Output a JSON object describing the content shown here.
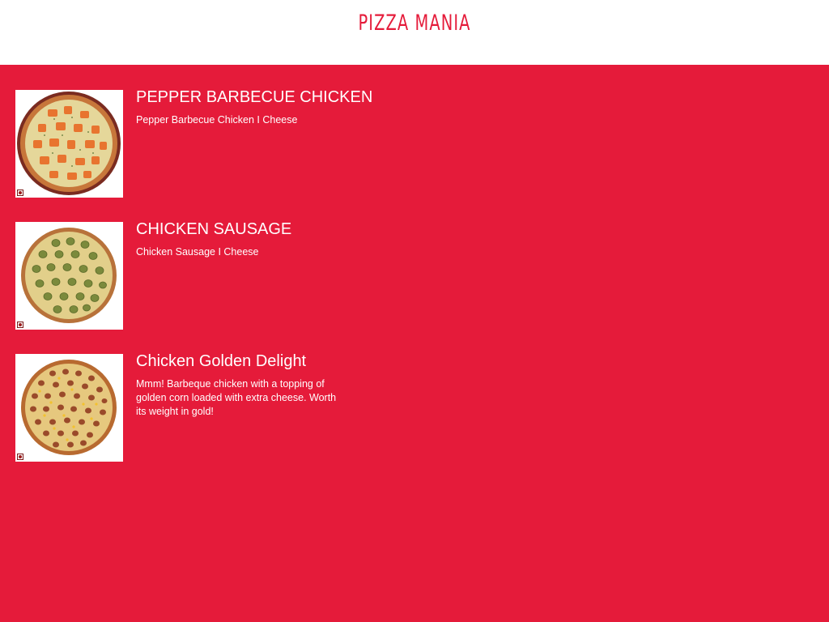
{
  "header": {
    "brand": "PIZZA MANIA"
  },
  "menu": {
    "items": [
      {
        "title": "PEPPER BARBECUE CHICKEN",
        "description": "Pepper Barbecue Chicken I Cheese",
        "image_icon": "pizza-pepper-barbecue-chicken-image"
      },
      {
        "title": "CHICKEN SAUSAGE",
        "description": "Chicken Sausage I Cheese",
        "image_icon": "pizza-chicken-sausage-image"
      },
      {
        "title": "Chicken Golden Delight",
        "description": "Mmm! Barbeque chicken with a topping of golden corn loaded with extra cheese. Worth its weight in gold!",
        "image_icon": "pizza-chicken-golden-delight-image"
      }
    ]
  },
  "colors": {
    "brand_red": "#e51b3a",
    "header_bg": "#ffffff",
    "text_light": "#ffffff"
  }
}
